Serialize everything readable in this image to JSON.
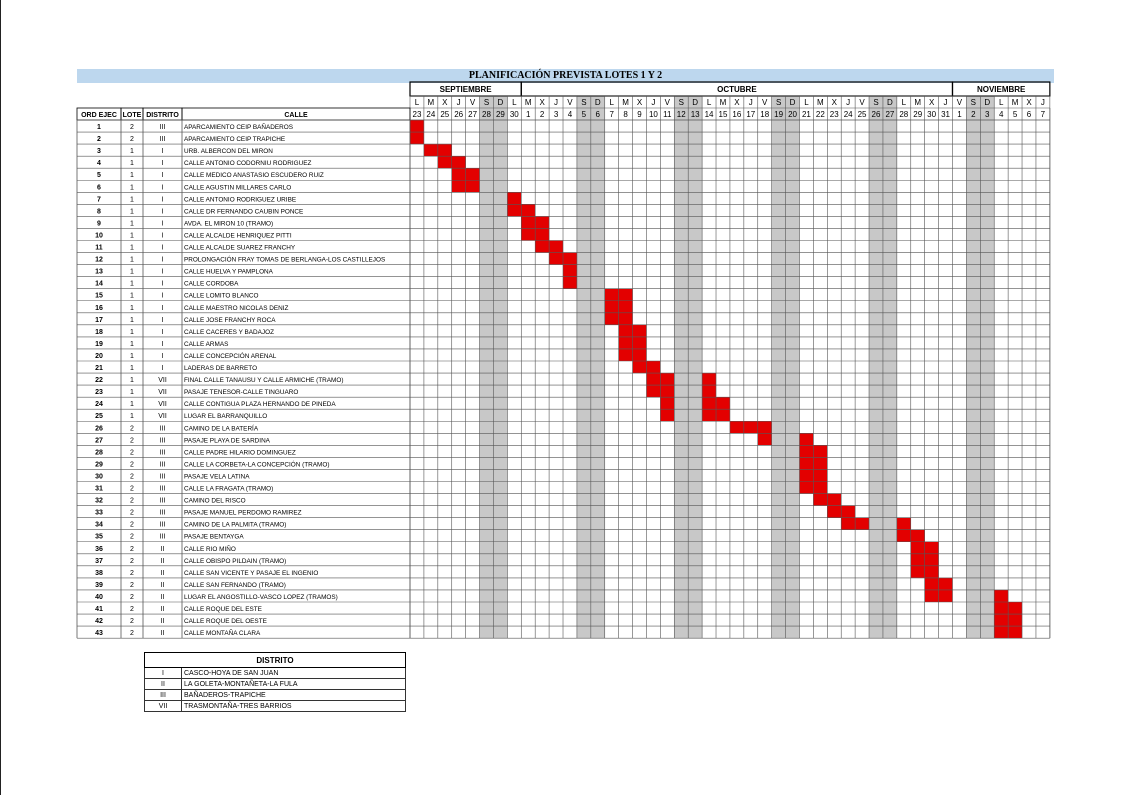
{
  "title": "PLANIFICACIÓN PREVISTA LOTES 1 Y 2",
  "months": [
    {
      "name": "SEPTIEMBRE",
      "from": 0,
      "to": 7
    },
    {
      "name": "OCTUBRE",
      "from": 8,
      "to": 38
    },
    {
      "name": "NOVIEMBRE",
      "from": 39,
      "to": 45
    }
  ],
  "weekdays": [
    "L",
    "M",
    "X",
    "J",
    "V",
    "S",
    "D",
    "L",
    "M",
    "X",
    "J",
    "V",
    "S",
    "D",
    "L",
    "M",
    "X",
    "J",
    "V",
    "S",
    "D",
    "L",
    "M",
    "X",
    "J",
    "V",
    "S",
    "D",
    "L",
    "M",
    "X",
    "J",
    "V",
    "S",
    "D",
    "L",
    "M",
    "X",
    "J",
    "V",
    "S",
    "D",
    "L",
    "M",
    "X",
    "J"
  ],
  "dates": [
    "23",
    "24",
    "25",
    "26",
    "27",
    "28",
    "29",
    "30",
    "1",
    "2",
    "3",
    "4",
    "5",
    "6",
    "7",
    "8",
    "9",
    "10",
    "11",
    "12",
    "13",
    "14",
    "15",
    "16",
    "17",
    "18",
    "19",
    "20",
    "21",
    "22",
    "23",
    "24",
    "25",
    "26",
    "27",
    "28",
    "29",
    "30",
    "31",
    "1",
    "2",
    "3",
    "4",
    "5",
    "6",
    "7"
  ],
  "weekday_overrides": {
    "38": "J",
    "39": "V",
    "40": "S",
    "41": "D",
    "42": "L",
    "43": "M",
    "44": "X",
    "45": "J"
  },
  "holiday_cols": [
    5,
    6,
    12,
    13,
    19,
    20,
    26,
    27,
    33,
    34,
    40,
    41
  ],
  "headers": {
    "ord": "ORD EJEC",
    "lote": "LOTE",
    "distrito": "DISTRITO",
    "calle": "CALLE"
  },
  "rows": [
    {
      "ord": "1",
      "lote": "2",
      "distrito": "III",
      "calle": "APARCAMIENTO CEIP BAÑADEROS",
      "cells": [
        0
      ]
    },
    {
      "ord": "2",
      "lote": "2",
      "distrito": "III",
      "calle": "APARCAMIENTO CEIP TRAPICHE",
      "cells": [
        0
      ]
    },
    {
      "ord": "3",
      "lote": "1",
      "distrito": "I",
      "calle": "URB. ALBERCON DEL MIRON",
      "cells": [
        1,
        2
      ]
    },
    {
      "ord": "4",
      "lote": "1",
      "distrito": "I",
      "calle": "CALLE ANTONIO CODORNIU RODRIGUEZ",
      "cells": [
        2,
        3
      ]
    },
    {
      "ord": "5",
      "lote": "1",
      "distrito": "I",
      "calle": "CALLE MEDICO ANASTASIO ESCUDERO RUIZ",
      "cells": [
        3,
        4
      ]
    },
    {
      "ord": "6",
      "lote": "1",
      "distrito": "I",
      "calle": "CALLE AGUSTIN MILLARES CARLO",
      "cells": [
        3,
        4
      ]
    },
    {
      "ord": "7",
      "lote": "1",
      "distrito": "I",
      "calle": "CALLE ANTONIO RODRIGUEZ URIBE",
      "cells": [
        7
      ]
    },
    {
      "ord": "8",
      "lote": "1",
      "distrito": "I",
      "calle": "CALLE DR FERNANDO CAUBIN PONCE",
      "cells": [
        7,
        8
      ]
    },
    {
      "ord": "9",
      "lote": "1",
      "distrito": "I",
      "calle": "AVDA. EL MIRON 10 (TRAMO)",
      "cells": [
        8,
        9
      ]
    },
    {
      "ord": "10",
      "lote": "1",
      "distrito": "I",
      "calle": "CALLE ALCALDE HENRIQUEZ PITTI",
      "cells": [
        8,
        9
      ]
    },
    {
      "ord": "11",
      "lote": "1",
      "distrito": "I",
      "calle": "CALLE ALCALDE SUAREZ FRANCHY",
      "cells": [
        9,
        10
      ]
    },
    {
      "ord": "12",
      "lote": "1",
      "distrito": "I",
      "calle": "PROLONGACIÓN FRAY TOMAS DE BERLANGA-LOS CASTILLEJOS",
      "cells": [
        10,
        11
      ]
    },
    {
      "ord": "13",
      "lote": "1",
      "distrito": "I",
      "calle": "CALLE HUELVA Y PAMPLONA",
      "cells": [
        11
      ]
    },
    {
      "ord": "14",
      "lote": "1",
      "distrito": "I",
      "calle": "CALLE CORDOBA",
      "cells": [
        11
      ]
    },
    {
      "ord": "15",
      "lote": "1",
      "distrito": "I",
      "calle": "CALLE LOMITO BLANCO",
      "cells": [
        14,
        15
      ]
    },
    {
      "ord": "16",
      "lote": "1",
      "distrito": "I",
      "calle": "CALLE MAESTRO NICOLAS DENIZ",
      "cells": [
        14,
        15
      ]
    },
    {
      "ord": "17",
      "lote": "1",
      "distrito": "I",
      "calle": "CALLE JOSE FRANCHY ROCA",
      "cells": [
        14,
        15
      ]
    },
    {
      "ord": "18",
      "lote": "1",
      "distrito": "I",
      "calle": "CALLE CACERES Y BADAJOZ",
      "cells": [
        15,
        16
      ]
    },
    {
      "ord": "19",
      "lote": "1",
      "distrito": "I",
      "calle": "CALLE ARMAS",
      "cells": [
        15,
        16
      ]
    },
    {
      "ord": "20",
      "lote": "1",
      "distrito": "I",
      "calle": "CALLE CONCEPCIÓN ARENAL",
      "cells": [
        15,
        16
      ]
    },
    {
      "ord": "21",
      "lote": "1",
      "distrito": "I",
      "calle": "LADERAS DE BARRETO",
      "cells": [
        16,
        17
      ]
    },
    {
      "ord": "22",
      "lote": "1",
      "distrito": "VII",
      "calle": "FINAL CALLE TANAUSU Y CALLE ARMICHE (TRAMO)",
      "cells": [
        17,
        18,
        21
      ]
    },
    {
      "ord": "23",
      "lote": "1",
      "distrito": "VII",
      "calle": "PASAJE TENESOR-CALLE TINGUARO",
      "cells": [
        17,
        18,
        21
      ]
    },
    {
      "ord": "24",
      "lote": "1",
      "distrito": "VII",
      "calle": "CALLE CONTIGUA PLAZA HERNANDO DE PINEDA",
      "cells": [
        18,
        21,
        22
      ]
    },
    {
      "ord": "25",
      "lote": "1",
      "distrito": "VII",
      "calle": "LUGAR EL BARRANQUILLO",
      "cells": [
        18,
        21,
        22
      ]
    },
    {
      "ord": "26",
      "lote": "2",
      "distrito": "III",
      "calle": "CAMINO DE LA BATERÍA",
      "cells": [
        23,
        24,
        25
      ]
    },
    {
      "ord": "27",
      "lote": "2",
      "distrito": "III",
      "calle": "PASAJE PLAYA DE SARDINA",
      "cells": [
        25,
        28
      ]
    },
    {
      "ord": "28",
      "lote": "2",
      "distrito": "III",
      "calle": "CALLE PADRE HILARIO DOMINGUEZ",
      "cells": [
        28,
        29
      ]
    },
    {
      "ord": "29",
      "lote": "2",
      "distrito": "III",
      "calle": "CALLE LA CORBETA-LA CONCEPCIÓN (TRAMO)",
      "cells": [
        28,
        29
      ]
    },
    {
      "ord": "30",
      "lote": "2",
      "distrito": "III",
      "calle": "PASAJE VELA LATINA",
      "cells": [
        28,
        29
      ]
    },
    {
      "ord": "31",
      "lote": "2",
      "distrito": "III",
      "calle": "CALLE LA FRAGATA (TRAMO)",
      "cells": [
        28,
        29
      ]
    },
    {
      "ord": "32",
      "lote": "2",
      "distrito": "III",
      "calle": "CAMINO DEL RISCO",
      "cells": [
        29,
        30
      ]
    },
    {
      "ord": "33",
      "lote": "2",
      "distrito": "III",
      "calle": "PASAJE MANUEL PERDOMO RAMIREZ",
      "cells": [
        30,
        31
      ]
    },
    {
      "ord": "34",
      "lote": "2",
      "distrito": "III",
      "calle": "CAMINO DE LA PALMITA (TRAMO)",
      "cells": [
        31,
        32,
        35
      ]
    },
    {
      "ord": "35",
      "lote": "2",
      "distrito": "III",
      "calle": "PASAJE BENTAYGA",
      "cells": [
        35,
        36
      ]
    },
    {
      "ord": "36",
      "lote": "2",
      "distrito": "II",
      "calle": "CALLE RIO MIÑO",
      "cells": [
        36,
        37
      ]
    },
    {
      "ord": "37",
      "lote": "2",
      "distrito": "II",
      "calle": "CALLE OBISPO PILDAIN (TRAMO)",
      "cells": [
        36,
        37
      ]
    },
    {
      "ord": "38",
      "lote": "2",
      "distrito": "II",
      "calle": "CALLE SAN VICENTE Y PASAJE EL INGENIO",
      "cells": [
        36,
        37
      ]
    },
    {
      "ord": "39",
      "lote": "2",
      "distrito": "II",
      "calle": "CALLE SAN FERNANDO (TRAMO)",
      "cells": [
        37,
        38
      ]
    },
    {
      "ord": "40",
      "lote": "2",
      "distrito": "II",
      "calle": "LUGAR EL ANGOSTILLO-VASCO LOPEZ (TRAMOS)",
      "cells": [
        37,
        38,
        42
      ]
    },
    {
      "ord": "41",
      "lote": "2",
      "distrito": "II",
      "calle": "CALLE ROQUE DEL ESTE",
      "cells": [
        42,
        43
      ]
    },
    {
      "ord": "42",
      "lote": "2",
      "distrito": "II",
      "calle": "CALLE ROQUE DEL OESTE",
      "cells": [
        42,
        43
      ]
    },
    {
      "ord": "43",
      "lote": "2",
      "distrito": "II",
      "calle": "CALLE MONTAÑA CLARA",
      "cells": [
        42,
        43
      ]
    }
  ],
  "legend": {
    "title": "DISTRITO",
    "items": [
      {
        "code": "I",
        "name": "CASCO-HOYA DE SAN JUAN"
      },
      {
        "code": "II",
        "name": "LA GOLETA-MONTAÑETA-LA FULA"
      },
      {
        "code": "III",
        "name": "BAÑADEROS-TRAPICHE"
      },
      {
        "code": "VII",
        "name": "TRASMONTAÑA-TRES BARRIOS"
      }
    ]
  },
  "colors": {
    "bar": "#e30000",
    "holiday": "#c8c8c8",
    "title_bg": "#bdd7ee",
    "grid": "#555555"
  }
}
